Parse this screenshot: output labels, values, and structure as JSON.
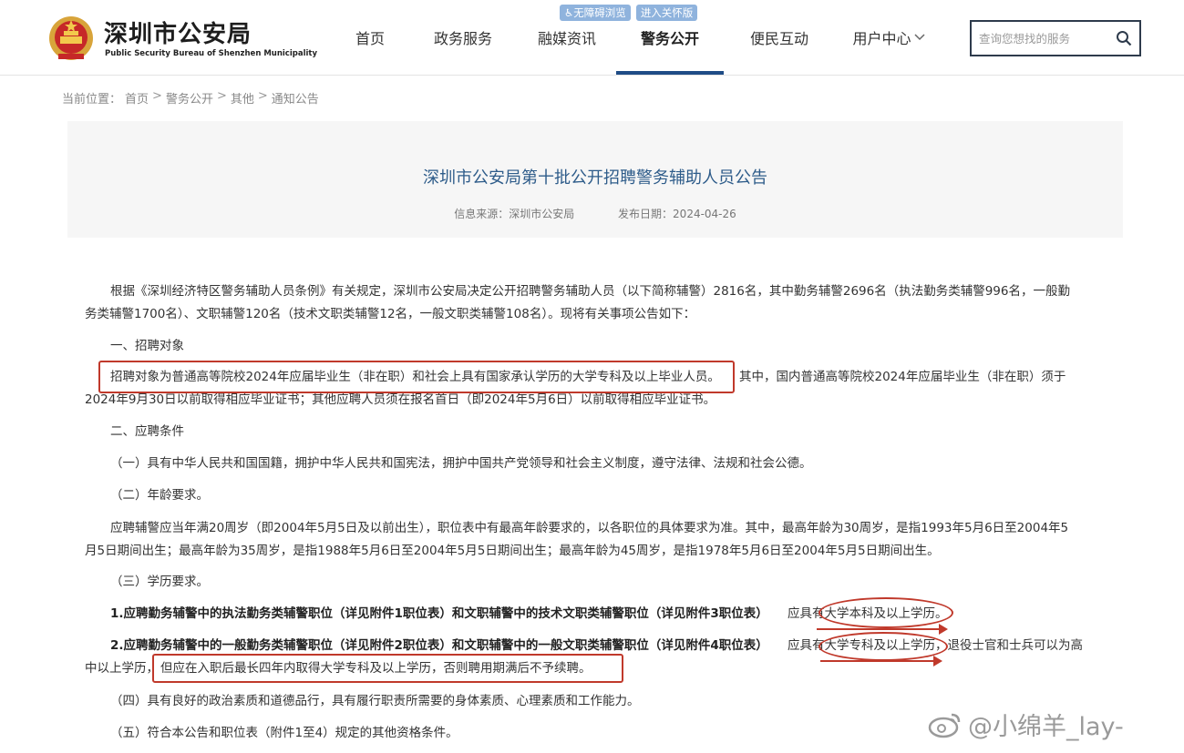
{
  "header": {
    "brand_cn": "深圳市公安局",
    "brand_en": "Public Security Bureau of Shenzhen Municipality",
    "accessibility": [
      "♿无障碍浏览",
      "进入关怀版"
    ],
    "nav": [
      "首页",
      "政务服务",
      "融媒资讯",
      "警务公开",
      "便民互动",
      "用户中心"
    ],
    "active_nav": "警务公开",
    "search_placeholder": "查询您想找的服务"
  },
  "breadcrumb": {
    "label": "当前位置：",
    "items": [
      "首页",
      "警务公开",
      "其他",
      "通知公告"
    ],
    "separator": ">"
  },
  "article": {
    "title": "深圳市公安局第十批公开招聘警务辅助人员公告",
    "source": "信息来源：深圳市公安局",
    "date": "发布日期：2024-04-26",
    "lines": [
      "根据《深圳经济特区警务辅助人员条例》有关规定，深圳市公安局决定公开招聘警务辅助人员（以下简称辅警）2816名，其中勤务辅警2696名（执法勤务类辅警996名，一般勤",
      "务类辅警1700名）、文职辅警120名（技术文职类辅警12名，一般文职类辅警108名）。现将有关事项公告如下：",
      "一、招聘对象",
      "招聘对象为普通高等院校2024年应届毕业生（非在职）和社会上具有国家承认学历的大学专科及以上毕业人员。",
      "其中，国内普通高等院校2024年应届毕业生（非在职）须于",
      "2024年9月30日以前取得相应毕业证书；其他应聘人员须在报名首日（即2024年5月6日）以前取得相应毕业证书。",
      "二、应聘条件",
      "（一）具有中华人民共和国国籍，拥护中华人民共和国宪法，拥护中国共产党领导和社会主义制度，遵守法律、法规和社会公德。",
      "（二）年龄要求。",
      "应聘辅警应当年满20周岁（即2004年5月5日及以前出生），职位表中有最高年龄要求的，以各职位的具体要求为准。其中，最高年龄为30周岁，是指1993年5月6日至2004年5",
      "月5日期间出生；最高年龄为35周岁，是指1988年5月6日至2004年5月5日期间出生；最高年龄为45周岁，是指1978年5月6日至2004年5月5日期间出生。",
      "（三）学历要求。",
      "1.应聘勤务辅警中的执法勤务类辅警职位（详见附件1职位表）和文职辅警中的技术文职类辅警职位（详见附件3职位表）",
      "应具有大学本科及以上学历。",
      "2.应聘勤务辅警中的一般勤务类辅警职位（详见附件2职位表）和文职辅警中的一般文职类辅警职位（详见附件4职位表）",
      "应具有大学专科及以上学历，退役士官和士兵可以为高",
      "中以上学历，",
      "但应在入职后最长四年内取得大学专科及以上学历，否则聘用期满后不予续聘。",
      "（四）具有良好的政治素质和道德品行，具有履行职责所需要的身体素质、心理素质和工作能力。",
      "（五）符合本公告和职位表（附件1至4）规定的其他资格条件。"
    ]
  },
  "watermark": "@小绵羊_lay-",
  "colors": {
    "accent": "#1f4c86",
    "title": "#2e5c8a",
    "annotation": "#c0392b"
  }
}
